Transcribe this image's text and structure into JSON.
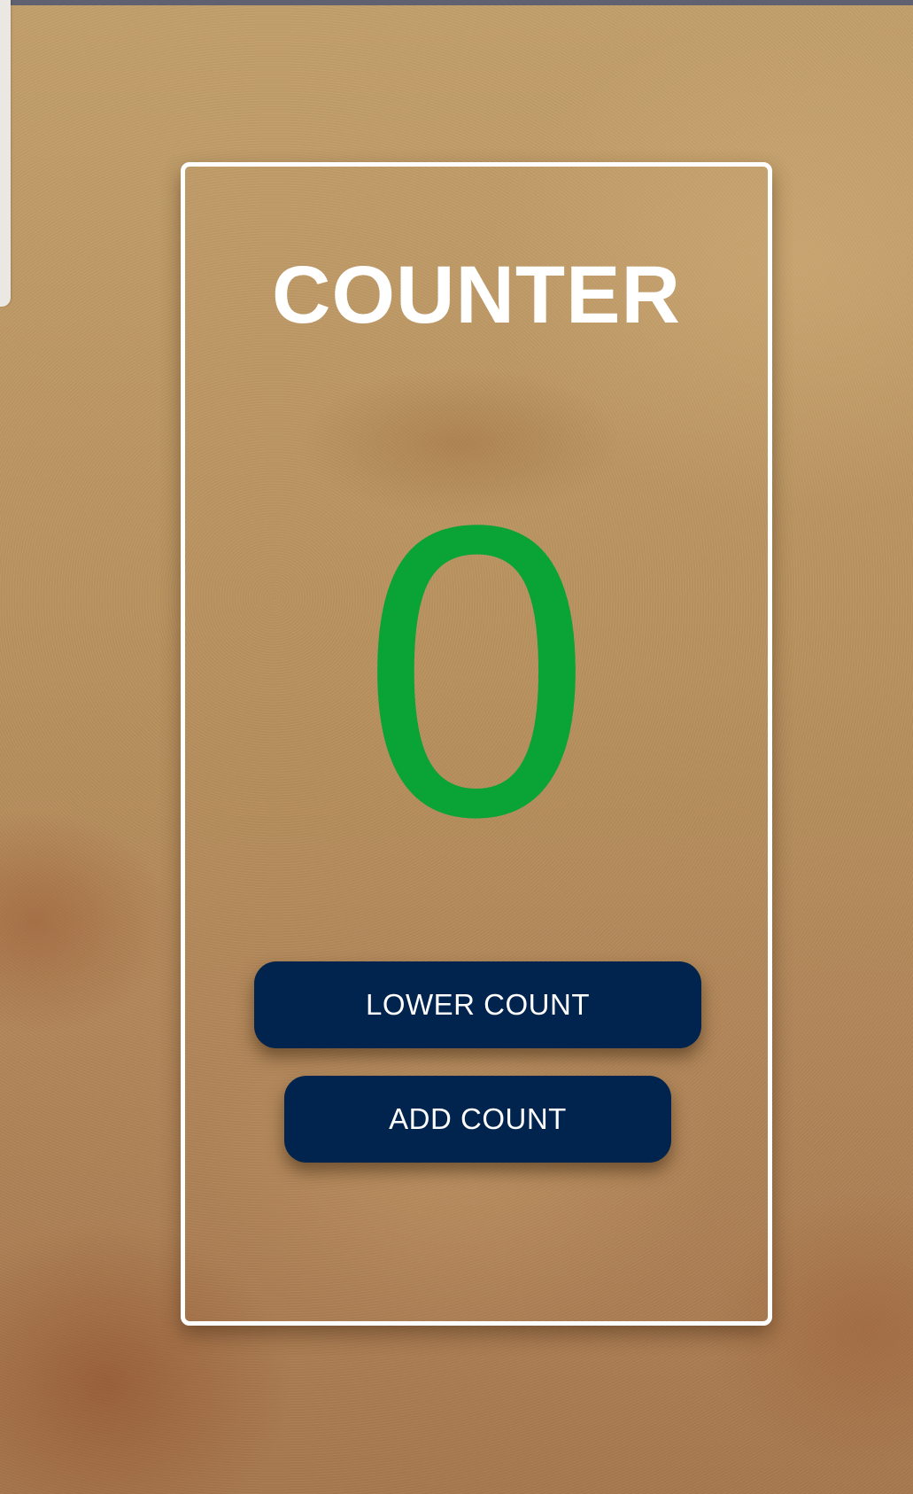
{
  "counter": {
    "title": "COUNTER",
    "count_value": "0",
    "count_color": "#0aa336",
    "lower_button_label": "LOWER COUNT",
    "add_button_label": "ADD COUNT",
    "button_color": "#00244d"
  }
}
